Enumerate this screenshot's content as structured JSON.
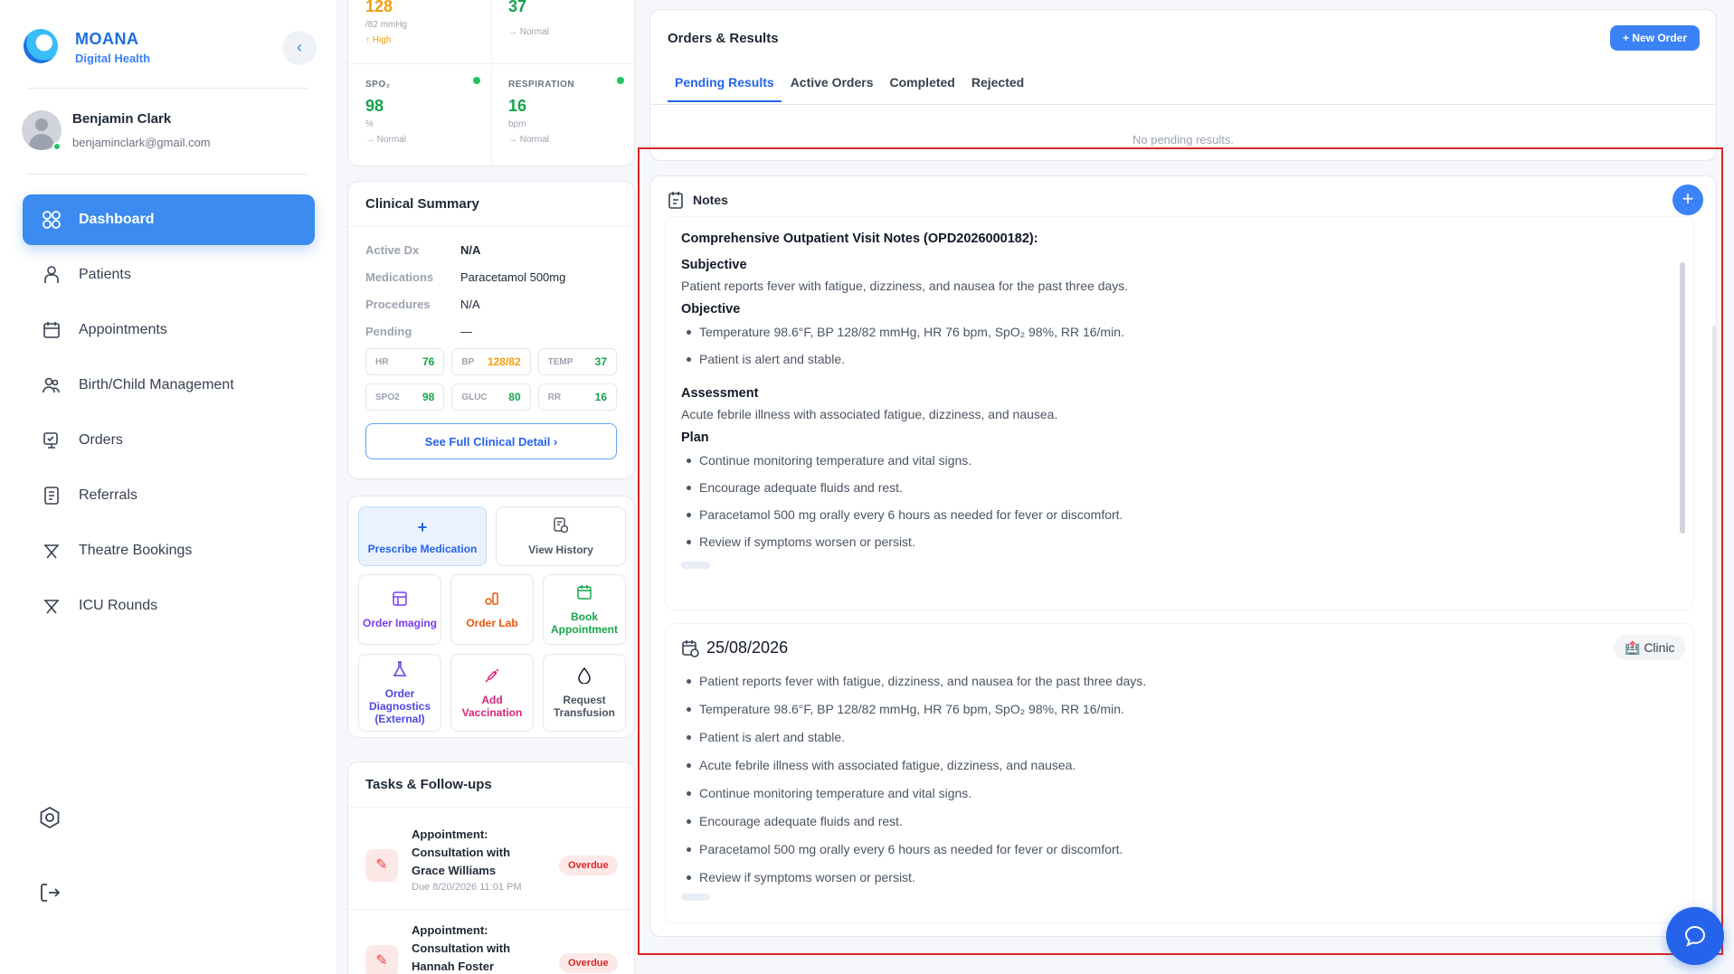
{
  "app": {
    "brand_name": "MOANA",
    "brand_sub": "Digital Health",
    "collapse_glyph": "‹"
  },
  "user": {
    "name": "Benjamin Clark",
    "email": "benjaminclark@gmail.com"
  },
  "nav": [
    {
      "label": "Dashboard",
      "icon": "dashboard-icon",
      "active": true
    },
    {
      "label": "Patients",
      "icon": "patients-icon"
    },
    {
      "label": "Appointments",
      "icon": "calendar-icon"
    },
    {
      "label": "Birth/Child Management",
      "icon": "family-icon"
    },
    {
      "label": "Orders",
      "icon": "orders-icon"
    },
    {
      "label": "Referrals",
      "icon": "referrals-icon"
    },
    {
      "label": "Theatre Bookings",
      "icon": "theatre-icon"
    },
    {
      "label": "ICU Rounds",
      "icon": "icu-icon"
    }
  ],
  "vitals": {
    "bp": {
      "value": "128",
      "unit": "/82 mmHg",
      "status": "↑ High"
    },
    "temp": {
      "value": "37",
      "status": "→ Normal"
    },
    "spo2": {
      "label": "SPO₂",
      "value": "98",
      "unit": "%",
      "status": "→ Normal"
    },
    "resp": {
      "label": "RESPIRATION",
      "value": "16",
      "unit": "bpm",
      "status": "→ Normal"
    }
  },
  "summary": {
    "title": "Clinical Summary",
    "rows": [
      {
        "k": "Active Dx",
        "v": "N/A"
      },
      {
        "k": "Medications",
        "v": "Paracetamol 500mg"
      },
      {
        "k": "Procedures",
        "v": "N/A"
      },
      {
        "k": "Pending",
        "v": "—"
      }
    ],
    "chips": [
      {
        "l": "HR",
        "v": "76",
        "color": "#16a34a"
      },
      {
        "l": "BP",
        "v": "128/82",
        "color": "#f59e0b"
      },
      {
        "l": "TEMP",
        "v": "37",
        "color": "#16a34a"
      },
      {
        "l": "SPO2",
        "v": "98",
        "color": "#16a34a"
      },
      {
        "l": "GLUC",
        "v": "80",
        "color": "#16a34a"
      },
      {
        "l": "RR",
        "v": "16",
        "color": "#16a34a"
      }
    ],
    "see_full": "See Full Clinical Detail ›"
  },
  "actions": {
    "prescribe": "Prescribe Medication",
    "history": "View History",
    "imaging": "Order Imaging",
    "lab": "Order Lab",
    "book": "Book Appointment",
    "diagnostics": "Order Diagnostics (External)",
    "vaccination": "Add Vaccination",
    "transfusion": "Request Transfusion"
  },
  "tasks": {
    "title": "Tasks & Follow-ups",
    "items": [
      {
        "title": "Appointment: Consultation with Grace Williams",
        "due": "Due 8/20/2026 11:01 PM",
        "badge": "Overdue"
      },
      {
        "title": "Appointment: Consultation with Hannah Foster",
        "badge": "Overdue"
      }
    ]
  },
  "orders": {
    "title": "Orders & Results",
    "new_order": "+ New Order",
    "tabs": [
      "Pending Results",
      "Active Orders",
      "Completed",
      "Rejected"
    ],
    "empty": "No pending results."
  },
  "notes": {
    "title": "Notes",
    "add": "+",
    "note1": {
      "title": "Comprehensive Outpatient Visit Notes (OPD2026000182):",
      "subjective_h": "Subjective",
      "subjective": "Patient reports fever with fatigue, dizziness, and nausea for the past three days.",
      "objective_h": "Objective",
      "objective": [
        "Temperature 98.6°F, BP 128/82 mmHg, HR 76 bpm, SpO₂ 98%, RR 16/min.",
        "Patient is alert and stable."
      ],
      "assessment_h": "Assessment",
      "assessment": "Acute febrile illness with associated fatigue, dizziness, and nausea.",
      "plan_h": "Plan",
      "plan": [
        "Continue monitoring temperature and vital signs.",
        "Encourage adequate fluids and rest.",
        "Paracetamol 500 mg orally every 6 hours as needed for fever or discomfort.",
        "Review if symptoms worsen or persist."
      ]
    },
    "note2": {
      "date": "25/08/2026",
      "badge": "🏥 Clinic",
      "items": [
        "Patient reports fever with fatigue, dizziness, and nausea for the past three days.",
        "Temperature 98.6°F, BP 128/82 mmHg, HR 76 bpm, SpO₂ 98%, RR 16/min.",
        "Patient is alert and stable.",
        "Acute febrile illness with associated fatigue, dizziness, and nausea.",
        "Continue monitoring temperature and vital signs.",
        "Encourage adequate fluids and rest.",
        "Paracetamol 500 mg orally every 6 hours as needed for fever or discomfort.",
        "Review if symptoms worsen or persist."
      ]
    }
  },
  "colors": {
    "accent": "#3b82f6",
    "danger": "#dc2626",
    "success": "#16a34a",
    "warning": "#f59e0b"
  }
}
